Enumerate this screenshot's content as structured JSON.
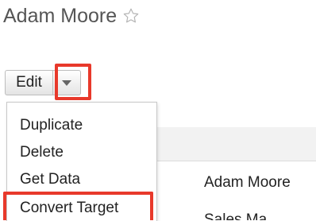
{
  "record": {
    "title": "Adam Moore"
  },
  "icons": {
    "favorite": "star-outline-icon",
    "dropdown": "caret-down-icon"
  },
  "actions": {
    "edit_label": "Edit",
    "menu_items": [
      "Duplicate",
      "Delete",
      "Get Data",
      "Convert Target"
    ]
  },
  "list": {
    "visible_name": "Adam Moore",
    "partial_name": "Sales Ma"
  },
  "colors": {
    "highlight": "#e8392b",
    "title_text": "#555555"
  }
}
